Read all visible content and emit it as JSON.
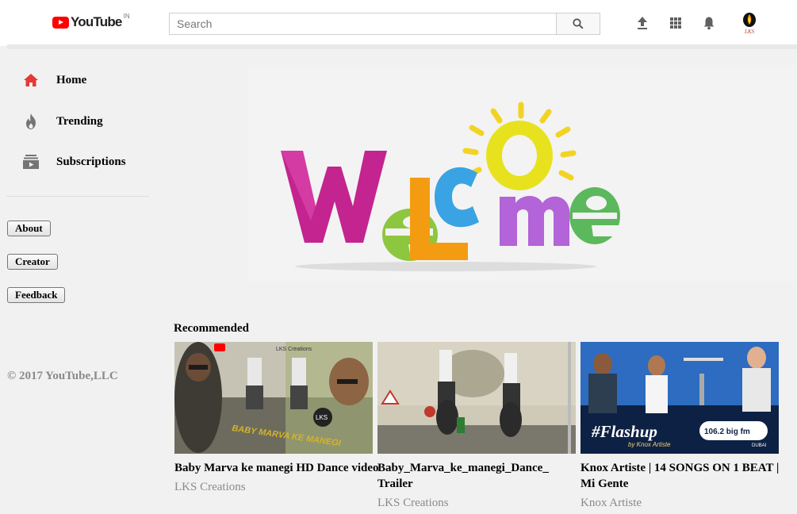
{
  "header": {
    "logo_text": "YouTube",
    "region": "IN",
    "search_placeholder": "Search"
  },
  "icons": {
    "upload": "upload-icon",
    "apps": "apps-grid-icon",
    "notifications": "bell-icon",
    "avatar_text": "LKS"
  },
  "sidebar": {
    "items": [
      {
        "label": "Home",
        "icon": "home-icon",
        "color": "#e53935"
      },
      {
        "label": "Trending",
        "icon": "flame-icon",
        "color": "#757575"
      },
      {
        "label": "Subscriptions",
        "icon": "subscriptions-icon",
        "color": "#757575"
      }
    ],
    "buttons": [
      "About",
      "Creator",
      "Feedback"
    ],
    "copyright": "© 2017 YouTube,LLC"
  },
  "main": {
    "recommended_label": "Recommended",
    "videos": [
      {
        "title": "Baby Marva ke manegi HD Dance video",
        "channel": "LKS Creations",
        "thumb_caption": "BABY MARVA KE MANEGI"
      },
      {
        "title": "Baby_Marva_ke_manegi_Dance_ Trailer",
        "channel": "LKS Creations"
      },
      {
        "title": "Knox Artiste | 14 SONGS ON 1 BEAT | Mi Gente",
        "channel": "Knox Artiste",
        "thumb_caption": "#Flashup",
        "thumb_sub": "by Knox Artiste",
        "badge": "106.2 big fm",
        "badge_sub": "DUBAI"
      }
    ]
  },
  "colors": {
    "brand_red": "#ff0000",
    "background": "#f1f1f1",
    "muted_text": "#8a8a8a"
  }
}
